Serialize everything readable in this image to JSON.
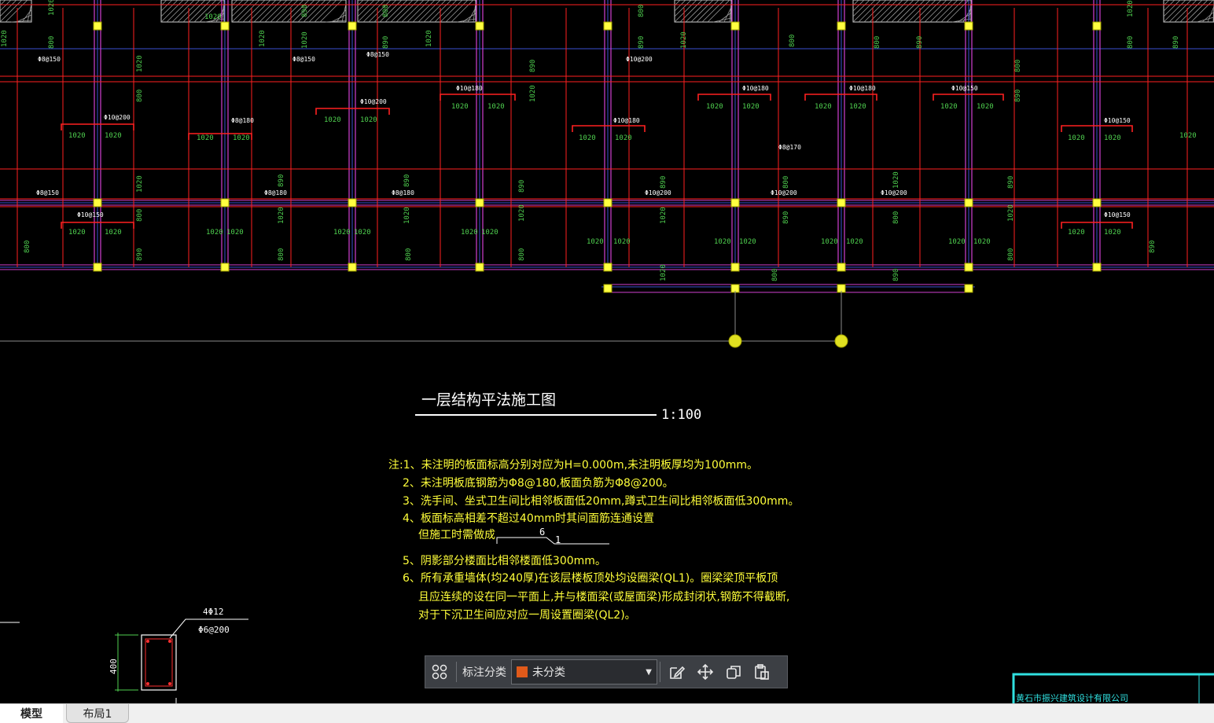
{
  "drawing": {
    "title": "一层结构平法施工图",
    "scale": "1:100",
    "notes": [
      "注:1、未注明的板面标高分别对应为H=0.000m,未注明板厚均为100mm。",
      "2、未注明板底钢筋为Φ8@180,板面负筋为Φ8@200。",
      "3、洗手间、坐式卫生间比相邻板面低20mm,蹲式卫生间比相邻板面低300mm。",
      "4、板面标高相差不超过40mm时其间面筋连通设置",
      "但施工时需做成",
      "5、阴影部分楼面比相邻楼面低300mm。",
      "6、所有承重墙体(均240厚)在该层楼板顶处均设圈梁(QL1)。圈梁梁顶平板顶",
      "且应连续的设在同一平面上,并与楼面梁(或屋面梁)形成封闭状,钢筋不得截断,",
      "对于下沉卫生间应对应一周设置圈梁(QL2)。"
    ],
    "step_detail": {
      "top": "6",
      "side": "1"
    },
    "section": {
      "height": "400",
      "main_bar": "4Φ12",
      "stirrup": "Φ6@200"
    },
    "title_block": "黄石市振兴建筑设计有限公司",
    "rebar_labels": [
      "Φ8@150",
      "Φ8@150",
      "Φ8@150",
      "Φ10@200",
      "Φ8@180",
      "Φ10@200",
      "Φ10@180",
      "Φ10@180",
      "Φ10@180",
      "Φ10@150",
      "Φ10@150",
      "Φ10@200",
      "Φ10@180",
      "Φ8@170",
      "Φ8@150",
      "Φ10@150",
      "Φ10@150",
      "Φ8@180",
      "Φ8@180",
      "Φ10@200",
      "Φ10@200",
      "Φ10@200"
    ],
    "dim_labels": [
      "1020",
      "800",
      "890",
      "1110",
      "570",
      "720",
      "660",
      "810",
      "1040"
    ]
  },
  "toolbar": {
    "grid_icon": "grid-icon",
    "label": "标注分类",
    "select_value": "未分类",
    "select_color": "#e05a1a",
    "edit_icon": "edit-icon",
    "move_icon": "move-icon",
    "copy_icon": "copy-icon",
    "paste_icon": "paste-icon"
  },
  "tabs": {
    "model": "模型",
    "layout": "布局1"
  },
  "colors": {
    "background": "#000000",
    "beam": "#ff2020",
    "wall": "#d040d0",
    "column": "#ffff40",
    "dimension": "#4fd04f",
    "grid": "#3a4fd0"
  }
}
